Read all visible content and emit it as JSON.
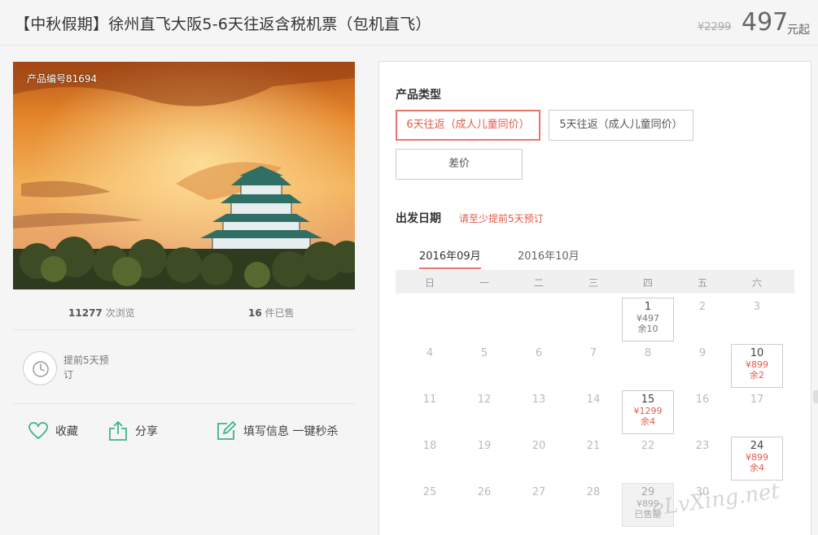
{
  "header": {
    "title": "【中秋假期】徐州直飞大阪5-6天往返含税机票（包机直飞）",
    "price_original": "¥2299",
    "price_current": "497",
    "price_unit": "元起"
  },
  "product": {
    "code": "产品编号81694",
    "views_count": "11277",
    "views_label": " 次浏览",
    "sold_count": "16",
    "sold_label": " 件已售",
    "advance_notice": "提前5天预订"
  },
  "actions": {
    "favorite": "收藏",
    "share": "分享",
    "fill_info": "填写信息 一键秒杀"
  },
  "booking": {
    "type_label": "产品类型",
    "options": [
      {
        "label": "6天往返（成人儿童同价）",
        "selected": true
      },
      {
        "label": "5天往返（成人儿童同价）",
        "selected": false
      },
      {
        "label": "差价",
        "selected": false
      }
    ],
    "date_label": "出发日期",
    "date_hint": "请至少提前5天预订",
    "months": [
      "2016年09月",
      "2016年10月"
    ],
    "active_month": "2016年09月",
    "weekdays": [
      "日",
      "一",
      "二",
      "三",
      "四",
      "五",
      "六"
    ],
    "days": [
      {
        "num": "1",
        "price": "¥497",
        "remaining": "余10",
        "style": "grey"
      },
      {
        "num": "2"
      },
      {
        "num": "3"
      },
      {
        "num": "4"
      },
      {
        "num": "5"
      },
      {
        "num": "6"
      },
      {
        "num": "7"
      },
      {
        "num": "8"
      },
      {
        "num": "9"
      },
      {
        "num": "10",
        "price": "¥899",
        "remaining": "余2",
        "style": "red"
      },
      {
        "num": "11"
      },
      {
        "num": "12"
      },
      {
        "num": "13"
      },
      {
        "num": "14"
      },
      {
        "num": "15",
        "price": "¥1299",
        "remaining": "余4",
        "style": "red"
      },
      {
        "num": "16"
      },
      {
        "num": "17"
      },
      {
        "num": "18"
      },
      {
        "num": "19"
      },
      {
        "num": "20"
      },
      {
        "num": "21"
      },
      {
        "num": "22"
      },
      {
        "num": "23"
      },
      {
        "num": "24",
        "price": "¥899",
        "remaining": "余4",
        "style": "red"
      },
      {
        "num": "25"
      },
      {
        "num": "26"
      },
      {
        "num": "27"
      },
      {
        "num": "28"
      },
      {
        "num": "29",
        "price": "¥899",
        "remaining": "已售罄",
        "style": "soldout"
      },
      {
        "num": "30"
      }
    ]
  },
  "watermark": "eLvXing.net",
  "colors": {
    "accent": "#e05c4c",
    "icon_green": "#3fb28f"
  }
}
